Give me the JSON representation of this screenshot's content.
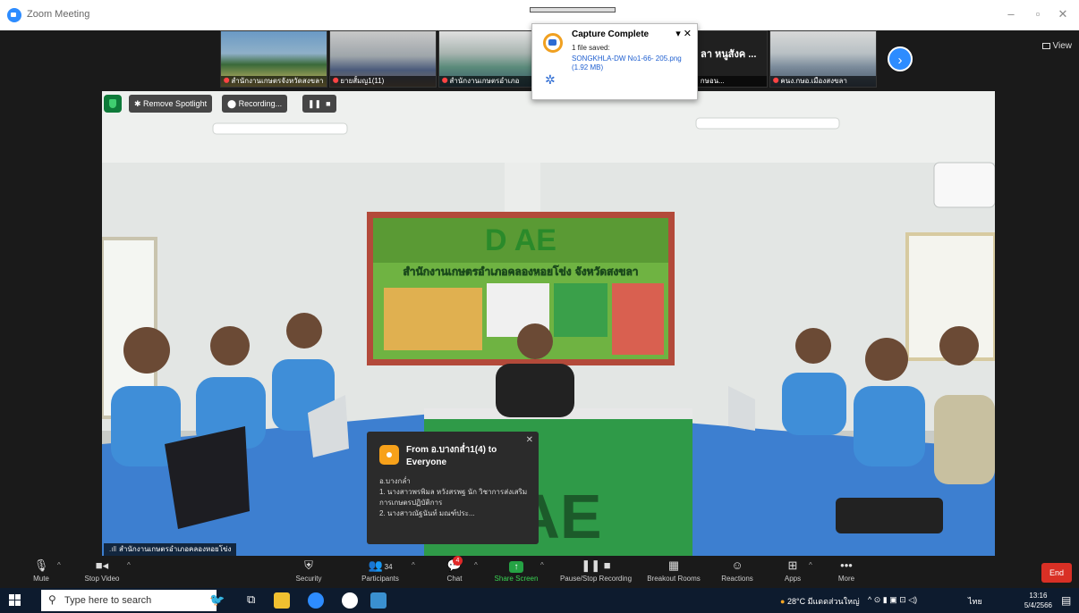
{
  "window": {
    "title": "Zoom Meeting"
  },
  "thumbnails": [
    {
      "label": "สำนักงานเกษตรจังหวัดสงขลา"
    },
    {
      "label": "ยายสั้มญ1(11)"
    },
    {
      "label": "สำนักงานเกษตรอำเภอ"
    },
    {
      "label": ""
    },
    {
      "label": "ลา หนูสังค..."
    },
    {
      "label": "คนง.กษอ.เมืองสงขลา"
    }
  ],
  "thumbnail_overlay": {
    "title": "ลา หนูสังค ...",
    "sub": "ลา หนูสังค กษอน..."
  },
  "view_button": {
    "label": "View"
  },
  "capture_popup": {
    "title": "Capture Complete",
    "subtitle": "1 file saved:",
    "file": "SONGKHLA-DW No1-66- 205.png (1.92 MB)"
  },
  "main_controls": {
    "remove_spotlight": "Remove Spotlight",
    "recording": "Recording..."
  },
  "banner": {
    "logo_text": "D AE",
    "office_name": "สำนักงานเกษตรอำเภอคลองหอยโข่ง จังหวัดสงขลา"
  },
  "speaker": {
    "name": "สำนักงานเกษตรอำเภอคลองหอยโข่ง"
  },
  "chat_notification": {
    "from": "From อ.บางกล่ำ1(4) to Everyone",
    "message": "อ.บางกล่ำ\n1. นางสาวพรพิมล หวังสรพฐ นัก วิชาการส่งเสริมการเกษตรปฏิบัติการ\n2. นางสาวณัฐนันท์ มณฑ์ประ..."
  },
  "toolbar": {
    "mute": "Mute",
    "stop_video": "Stop Video",
    "security": "Security",
    "participants": "Participants",
    "participants_count": "34",
    "chat": "Chat",
    "chat_badge": "4",
    "share_screen": "Share Screen",
    "pause_recording": "Pause/Stop Recording",
    "breakout": "Breakout Rooms",
    "reactions": "Reactions",
    "apps": "Apps",
    "more": "More",
    "end": "End"
  },
  "taskbar": {
    "search_placeholder": "Type here to search",
    "weather": "28°C มีแดดส่วนใหญ่",
    "lang": "ไทย",
    "time": "13:16",
    "date": "5/4/2566"
  }
}
